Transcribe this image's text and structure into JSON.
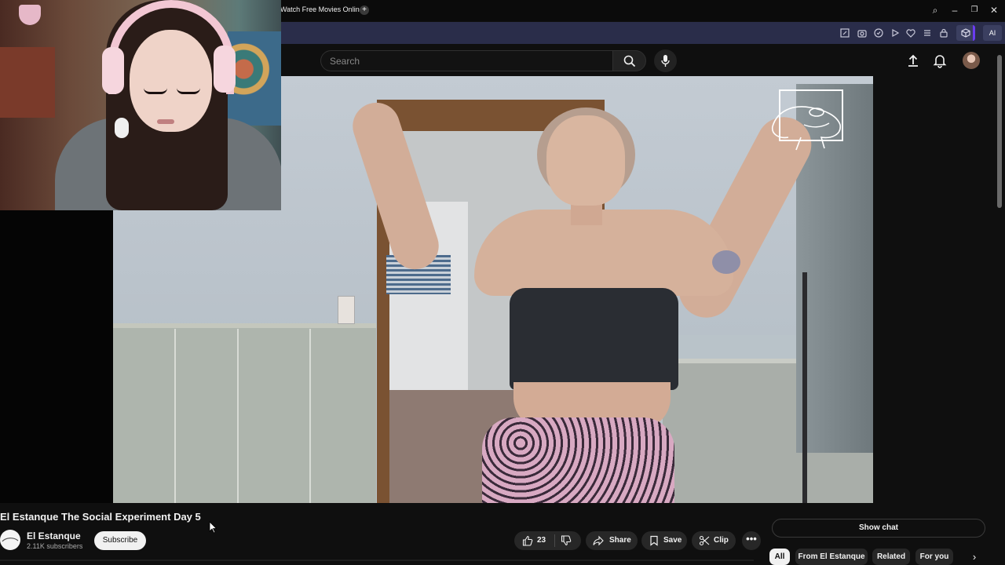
{
  "browser": {
    "tab_title": "Watch Free Movies Online",
    "new_tab": "+",
    "controls": {
      "search": "⌕",
      "minimize": "–",
      "restore": "❐",
      "close": "✕"
    },
    "extensions": [
      "edit-icon",
      "camera-icon",
      "shield-icon",
      "play-icon",
      "heart-icon",
      "menu-icon",
      "lock-icon",
      "cube-icon"
    ],
    "ai_label": "AI",
    "accent_color": "#2a2d4a"
  },
  "youtube": {
    "search_placeholder": "Search",
    "header_icons": [
      "upload-icon",
      "bell-icon",
      "avatar"
    ]
  },
  "video": {
    "title": "El Estanque The Social Experiment Day 5"
  },
  "channel": {
    "name": "El Estanque",
    "subscribers": "2.11K subscribers",
    "subscribe_label": "Subscribe"
  },
  "actions": {
    "like_count": "23",
    "share_label": "Share",
    "save_label": "Save",
    "clip_label": "Clip",
    "more_label": "•••"
  },
  "sidebar": {
    "show_chat": "Show chat",
    "chips": [
      "All",
      "From El Estanque",
      "Related",
      "For you"
    ],
    "next_arrow": "›"
  }
}
